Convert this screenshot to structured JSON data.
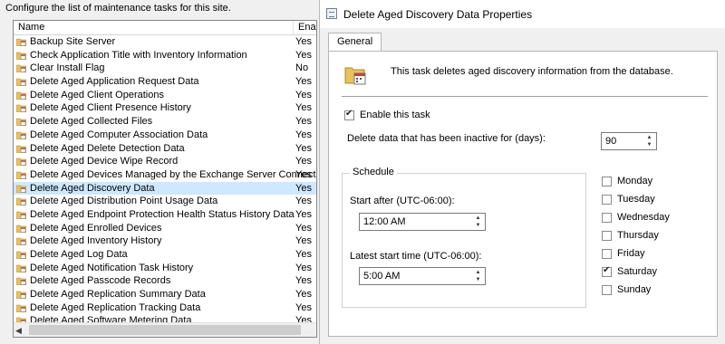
{
  "left_panel": {
    "caption": "Configure the list of maintenance tasks for this site.",
    "columns": {
      "name": "Name",
      "enabled": "Enab"
    },
    "tasks": [
      {
        "name": "Backup Site Server",
        "enabled": "Yes"
      },
      {
        "name": "Check Application Title with Inventory Information",
        "enabled": "Yes"
      },
      {
        "name": "Clear Install Flag",
        "enabled": "No"
      },
      {
        "name": "Delete Aged Application Request Data",
        "enabled": "Yes"
      },
      {
        "name": "Delete Aged Client Operations",
        "enabled": "Yes"
      },
      {
        "name": "Delete Aged Client Presence History",
        "enabled": "Yes"
      },
      {
        "name": "Delete Aged Collected Files",
        "enabled": "Yes"
      },
      {
        "name": "Delete Aged Computer Association Data",
        "enabled": "Yes"
      },
      {
        "name": "Delete Aged Delete Detection Data",
        "enabled": "Yes"
      },
      {
        "name": "Delete Aged Device Wipe Record",
        "enabled": "Yes"
      },
      {
        "name": "Delete Aged Devices Managed by the Exchange Server Connector",
        "enabled": "Yes"
      },
      {
        "name": "Delete Aged Discovery Data",
        "enabled": "Yes",
        "selected": true
      },
      {
        "name": "Delete Aged Distribution Point Usage Data",
        "enabled": "Yes"
      },
      {
        "name": "Delete Aged Endpoint Protection Health Status History Data",
        "enabled": "Yes"
      },
      {
        "name": "Delete Aged Enrolled Devices",
        "enabled": "Yes"
      },
      {
        "name": "Delete Aged Inventory History",
        "enabled": "Yes"
      },
      {
        "name": "Delete Aged Log Data",
        "enabled": "Yes"
      },
      {
        "name": "Delete Aged Notification Task History",
        "enabled": "Yes"
      },
      {
        "name": "Delete Aged Passcode Records",
        "enabled": "Yes"
      },
      {
        "name": "Delete Aged Replication Summary Data",
        "enabled": "Yes"
      },
      {
        "name": "Delete Aged Replication Tracking Data",
        "enabled": "Yes"
      },
      {
        "name": "Delete Aged Software Metering Data",
        "enabled": "Yes"
      }
    ],
    "scroll_left_arrow": "◀"
  },
  "dialog": {
    "title": "Delete Aged Discovery Data Properties",
    "tab_general": "General",
    "description": "This task deletes aged discovery information from the database.",
    "enable_task_label": "Enable this task",
    "enable_task_checked": true,
    "inactive_days_label": "Delete data that has been inactive for (days):",
    "inactive_days_value": "90",
    "schedule": {
      "title": "Schedule",
      "start_after_label": "Start after (UTC-06:00):",
      "start_after_value": "12:00 AM",
      "latest_start_label": "Latest start time (UTC-06:00):",
      "latest_start_value": "5:00 AM"
    },
    "days": [
      {
        "label": "Monday",
        "checked": false
      },
      {
        "label": "Tuesday",
        "checked": false
      },
      {
        "label": "Wednesday",
        "checked": false
      },
      {
        "label": "Thursday",
        "checked": false
      },
      {
        "label": "Friday",
        "checked": false
      },
      {
        "label": "Saturday",
        "checked": true
      },
      {
        "label": "Sunday",
        "checked": false
      }
    ],
    "spinner_up": "▲",
    "spinner_down": "▼"
  },
  "colors": {
    "selection": "#cde8ff",
    "folder": "#e8c25a"
  },
  "icons": {
    "task": "folder-calendar-icon",
    "dialog": "properties-window-icon"
  }
}
